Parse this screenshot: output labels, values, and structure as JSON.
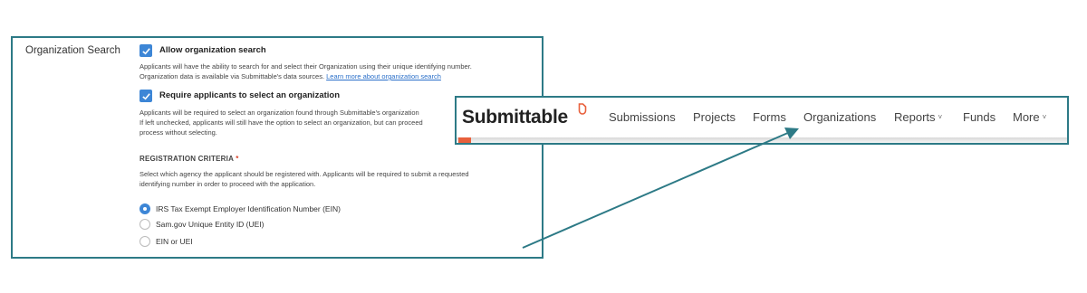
{
  "settings": {
    "section_label": "Organization Search",
    "allow_search": {
      "label": "Allow organization search",
      "checked": true,
      "help_line1": "Applicants will have the ability to search for and select their Organization using their unique identifying number.",
      "help_line2": "Organization data is available via Submittable's data sources. ",
      "help_link": "Learn more about organization search"
    },
    "require_org": {
      "label": "Require applicants to select an organization",
      "checked": true,
      "help_line1": "Applicants will be required to select an organization found through Submittable's organization",
      "help_line2": "If left unchecked, applicants will still have the option to select an organization, but can proceed",
      "help_line3": "process without selecting."
    },
    "registration": {
      "title": "REGISTRATION CRITERIA",
      "required_mark": "*",
      "help_line1": "Select which agency the applicant should be registered with. Applicants will be required to submit a requested",
      "help_line2": "identifying number in order to proceed with the application.",
      "options": [
        {
          "label": "IRS Tax Exempt Employer Identification Number (EIN)",
          "selected": true
        },
        {
          "label": "Sam.gov Unique Entity ID (UEI)",
          "selected": false
        },
        {
          "label": "EIN or UEI",
          "selected": false
        }
      ]
    }
  },
  "navbar": {
    "logo": "Submittable",
    "items": [
      {
        "label": "Submissions"
      },
      {
        "label": "Projects"
      },
      {
        "label": "Forms"
      },
      {
        "label": "Organizations"
      },
      {
        "label": "Reports",
        "chevron": "˅"
      },
      {
        "label": "Funds"
      },
      {
        "label": "More",
        "chevron": "˅"
      }
    ]
  },
  "colors": {
    "frame": "#2d7a86",
    "accent": "#e8603c",
    "checkbox": "#3d86d6",
    "link": "#2a6fc9"
  }
}
